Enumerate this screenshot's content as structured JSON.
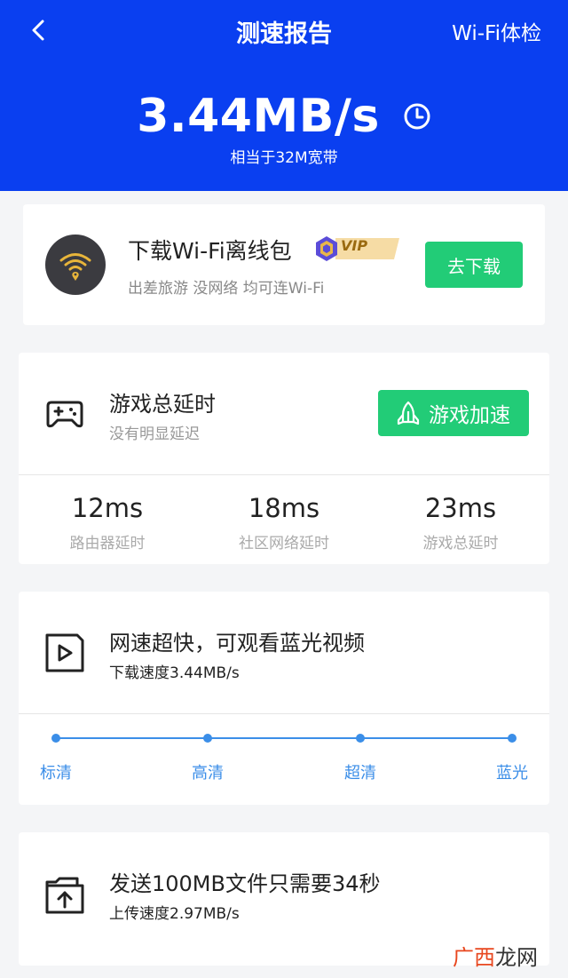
{
  "header": {
    "title": "测速报告",
    "wifi_check_label": "Wi-Fi体检",
    "speed_value": "3.44MB/s",
    "speed_equivalent": "相当于32M宽带",
    "background_color": "#0a3ff0"
  },
  "offline_pack": {
    "title": "下载Wi-Fi离线包",
    "badge": "VIP",
    "subtitle": "出差旅游 没网络 均可连Wi-Fi",
    "button_label": "去下载",
    "icon": "wifi-location-icon"
  },
  "game_latency": {
    "title": "游戏总延时",
    "subtitle": "没有明显延迟",
    "button_label": "游戏加速",
    "icon": "gamepad-icon",
    "stats": [
      {
        "value": "12ms",
        "label": "路由器延时"
      },
      {
        "value": "18ms",
        "label": "社区网络延时"
      },
      {
        "value": "23ms",
        "label": "游戏总延时"
      }
    ]
  },
  "video": {
    "title": "网速超快，可观看蓝光视频",
    "subtitle": "下载速度3.44MB/s",
    "icon": "video-play-icon",
    "qualities": [
      "标清",
      "高清",
      "超清",
      "蓝光"
    ]
  },
  "upload": {
    "title": "发送100MB文件只需要34秒",
    "subtitle": "上传速度2.97MB/s",
    "icon": "folder-upload-icon"
  },
  "watermark": {
    "part1": "广西",
    "part2": "龙网"
  },
  "colors": {
    "accent_green": "#22cc77",
    "quality_blue": "#3b8ee8"
  }
}
